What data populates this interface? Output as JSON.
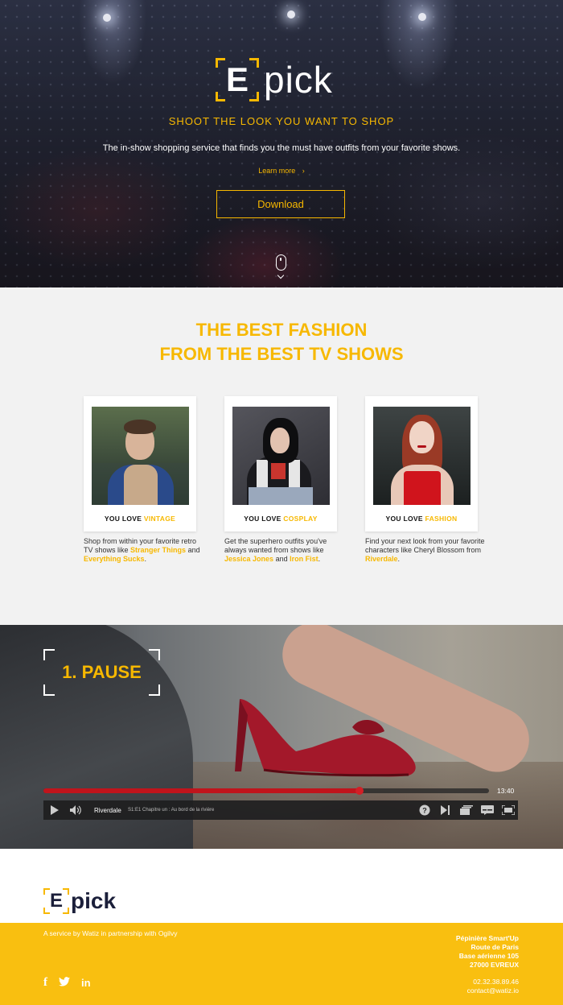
{
  "hero": {
    "logo_letter": "E",
    "logo_rest": "pick",
    "tagline": "SHOOT THE LOOK YOU WANT TO SHOP",
    "description": "The in-show shopping service that finds you the must have outfits from your favorite shows.",
    "learn_more": "Learn more",
    "learn_more_icon": "chevron-right-icon",
    "download_label": "Download",
    "scroll_icon": "mouse-scroll-icon"
  },
  "fashion": {
    "title_line1": "THE BEST FASHION",
    "title_line2": "FROM THE BEST TV SHOWS",
    "cards": [
      {
        "caption_prefix": "YOU LOVE",
        "caption_highlight": "VINTAGE",
        "desc_text1": "Shop from within your favorite retro TV shows like",
        "link1": "Stranger Things",
        "desc_and": "and",
        "link2": "Everything Sucks",
        "desc_end": "."
      },
      {
        "caption_prefix": "YOU LOVE",
        "caption_highlight": "COSPLAY",
        "desc_text1": "Get the superhero outfits you've always wanted from shows like",
        "link1": "Jessica Jones",
        "desc_and": "and",
        "link2": "Iron Fist",
        "desc_end": "."
      },
      {
        "caption_prefix": "YOU LOVE",
        "caption_highlight": "FASHION",
        "desc_text1": "Find your next look from your favorite characters like Cheryl Blossom from",
        "link1": "Riverdale",
        "desc_end": "."
      }
    ]
  },
  "video": {
    "step_label": "1. PAUSE",
    "time_total": "13:40",
    "progress": 0.71,
    "show_name": "Riverdale",
    "episode": "S1:E1  Chapitre un : Au bord de la rivière",
    "controls": [
      "play-icon",
      "volume-icon",
      "help-icon",
      "next-icon",
      "episodes-icon",
      "subtitles-icon",
      "fullscreen-icon"
    ]
  },
  "footer": {
    "logo_letter": "E",
    "logo_rest": "pick",
    "partner_text": "A service by Watiz in partnership with Ogilvy",
    "address": [
      "Pépinière Smart'Up",
      "Route de Paris",
      "Base aérienne 105",
      "27000 EVREUX"
    ],
    "phone": "02.32.38.89.46",
    "email": "contact@watiz.io",
    "social": {
      "facebook": "f",
      "twitter": "twitter-icon",
      "linkedin": "in"
    }
  },
  "colors": {
    "accent": "#f7b800",
    "footer_bg": "#f9bf10",
    "progress_red": "#c0141c",
    "logo_dark": "#1b1f3a"
  }
}
